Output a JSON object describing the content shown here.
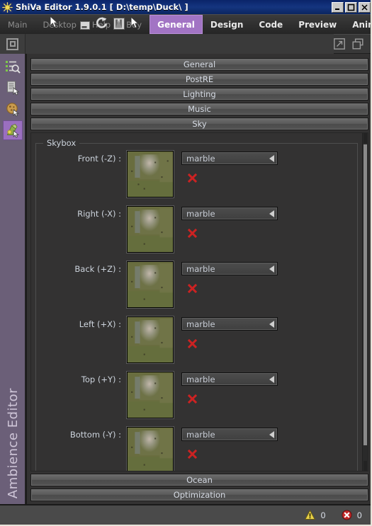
{
  "window": {
    "title": "ShiVa Editor 1.9.0.1 [ D:\\temp\\Duck\\ ]",
    "app_icon": "sun-icon",
    "minimize_label": "_",
    "maximize_label": "□",
    "close_label": "✕"
  },
  "menu": {
    "items": [
      {
        "label": "Main"
      },
      {
        "label": "Desktop"
      },
      {
        "label": "Help"
      },
      {
        "label": "Buy"
      }
    ]
  },
  "tabs": [
    {
      "label": "General",
      "active": true
    },
    {
      "label": "Design",
      "active": false
    },
    {
      "label": "Code",
      "active": false
    },
    {
      "label": "Preview",
      "active": false
    },
    {
      "label": "Animation",
      "active": false
    }
  ],
  "toolbar": {
    "module_icon": "square-outline-icon",
    "right_icons": [
      {
        "name": "expand-window-icon"
      },
      {
        "name": "cascade-windows-icon"
      }
    ]
  },
  "sidebar": {
    "title": "Ambience Editor",
    "items": [
      {
        "name": "data-explorer-icon",
        "label": "Data Explorer",
        "active": false
      },
      {
        "name": "attributes-icon",
        "label": "Attributes",
        "active": false
      },
      {
        "name": "resources-icon",
        "label": "Resources",
        "active": false
      },
      {
        "name": "ambience-icon",
        "label": "Ambience",
        "active": true
      }
    ]
  },
  "panels": {
    "top": [
      {
        "label": "General"
      },
      {
        "label": "PostRE"
      },
      {
        "label": "Lighting"
      },
      {
        "label": "Music"
      },
      {
        "label": "Sky"
      }
    ],
    "bottom": [
      {
        "label": "Ocean"
      },
      {
        "label": "Optimization"
      }
    ]
  },
  "skybox": {
    "legend": "Skybox",
    "faces": [
      {
        "label": "Front (-Z) :",
        "texture": "marble",
        "clear_label": "clear"
      },
      {
        "label": "Right (-X) :",
        "texture": "marble",
        "clear_label": "clear"
      },
      {
        "label": "Back (+Z) :",
        "texture": "marble",
        "clear_label": "clear"
      },
      {
        "label": "Left (+X) :",
        "texture": "marble",
        "clear_label": "clear"
      },
      {
        "label": "Top (+Y) :",
        "texture": "marble",
        "clear_label": "clear"
      },
      {
        "label": "Bottom (-Y) :",
        "texture": "marble",
        "clear_label": "clear"
      }
    ]
  },
  "statusbar": {
    "warnings": {
      "icon": "warning-triangle-icon",
      "count": "0"
    },
    "errors": {
      "icon": "error-circle-icon",
      "count": "0"
    }
  },
  "colors": {
    "titlebar": "#0a246a",
    "accent": "#a274c4",
    "rail": "#6b5f78",
    "panel_bg": "#333232",
    "text": "#cdd4dd",
    "error_red": "#cc2222",
    "warning_yellow": "#e8d24a"
  }
}
